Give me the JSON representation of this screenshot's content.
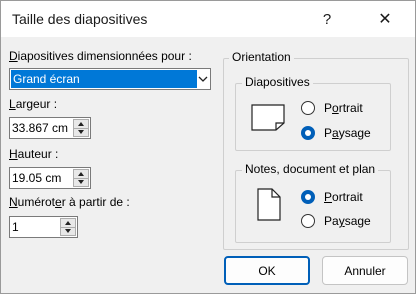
{
  "dialog": {
    "title": "Taille des diapositives",
    "help_glyph": "?",
    "close_glyph": "✕"
  },
  "size": {
    "label_underline": "D",
    "label_rest": "iapositives dimensionnées pour :",
    "selected": "Grand écran"
  },
  "width": {
    "label_underline": "L",
    "label_rest": "argeur :",
    "value": "33.867 cm"
  },
  "height": {
    "label_underline": "H",
    "label_rest": "auteur :",
    "value": "19.05 cm"
  },
  "numbering": {
    "label_underline": "N",
    "label_rest": "umérot",
    "label_underline2": "e",
    "label_rest2": "r à partir de :",
    "value": "1"
  },
  "orientation": {
    "title": "Orientation",
    "slides": {
      "title": "Diapositives",
      "portrait_pre": "P",
      "portrait_u": "o",
      "portrait_post": "rtrait",
      "landscape_pre": "P",
      "landscape_u": "a",
      "landscape_post": "ysage",
      "selected": "landscape"
    },
    "notes": {
      "title": "Notes, document et plan",
      "portrait_pre": "",
      "portrait_u": "P",
      "portrait_post": "ortrait",
      "landscape_pre": "Pa",
      "landscape_u": "y",
      "landscape_post": "sage",
      "selected": "portrait"
    }
  },
  "buttons": {
    "ok": "OK",
    "cancel": "Annuler"
  },
  "colors": {
    "accent": "#005fb8",
    "selection": "#0078d7"
  },
  "icons": {
    "slides_orientation": "landscape-page-icon",
    "notes_orientation": "portrait-page-icon"
  }
}
